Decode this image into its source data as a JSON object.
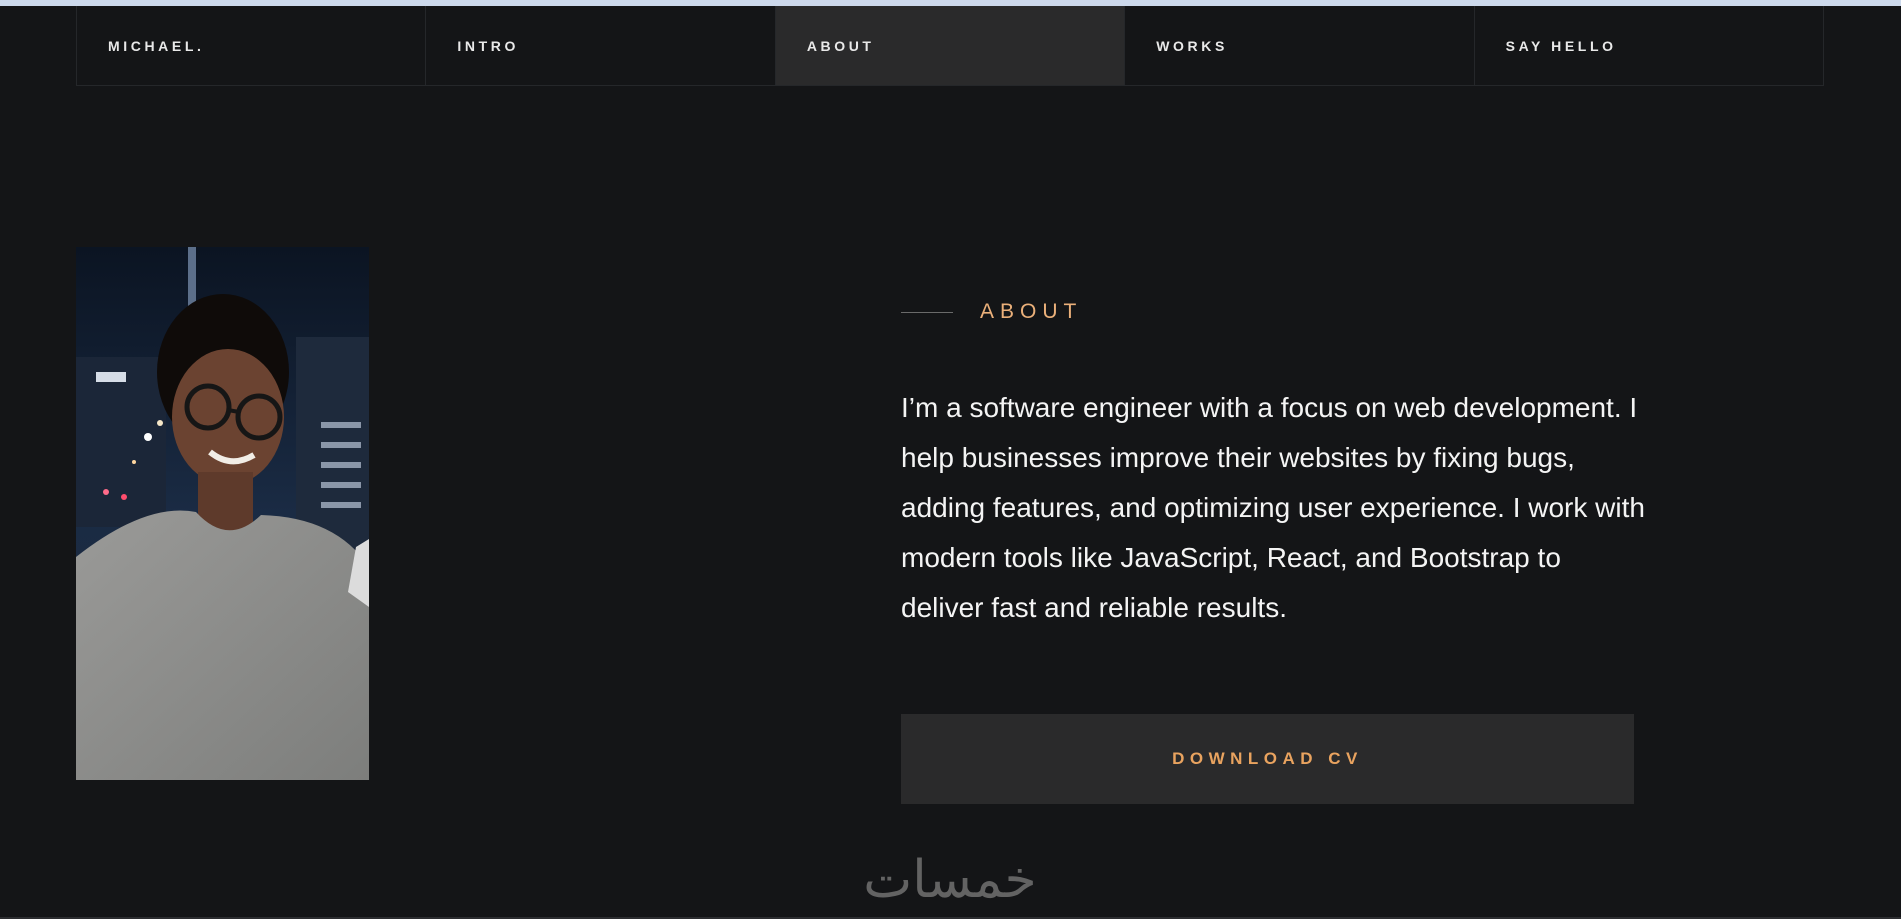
{
  "nav": {
    "items": [
      {
        "label": "MICHAEL.",
        "active": false
      },
      {
        "label": "INTRO",
        "active": false
      },
      {
        "label": "ABOUT",
        "active": true
      },
      {
        "label": "WORKS",
        "active": false
      },
      {
        "label": "SAY HELLO",
        "active": false
      }
    ]
  },
  "about": {
    "kicker": "ABOUT",
    "text": "I’m a software engineer with a focus on web development. I help businesses improve their websites by fixing bugs, adding features, and optimizing user experience. I work with modern tools like JavaScript, React, and Bootstrap to deliver fast and reliable results.",
    "button_label": "DOWNLOAD CV"
  },
  "watermark": {
    "text": "خمسات"
  },
  "colors": {
    "background": "#141517",
    "accent": "#ebb07a",
    "nav_active": "#2a2a2b"
  }
}
